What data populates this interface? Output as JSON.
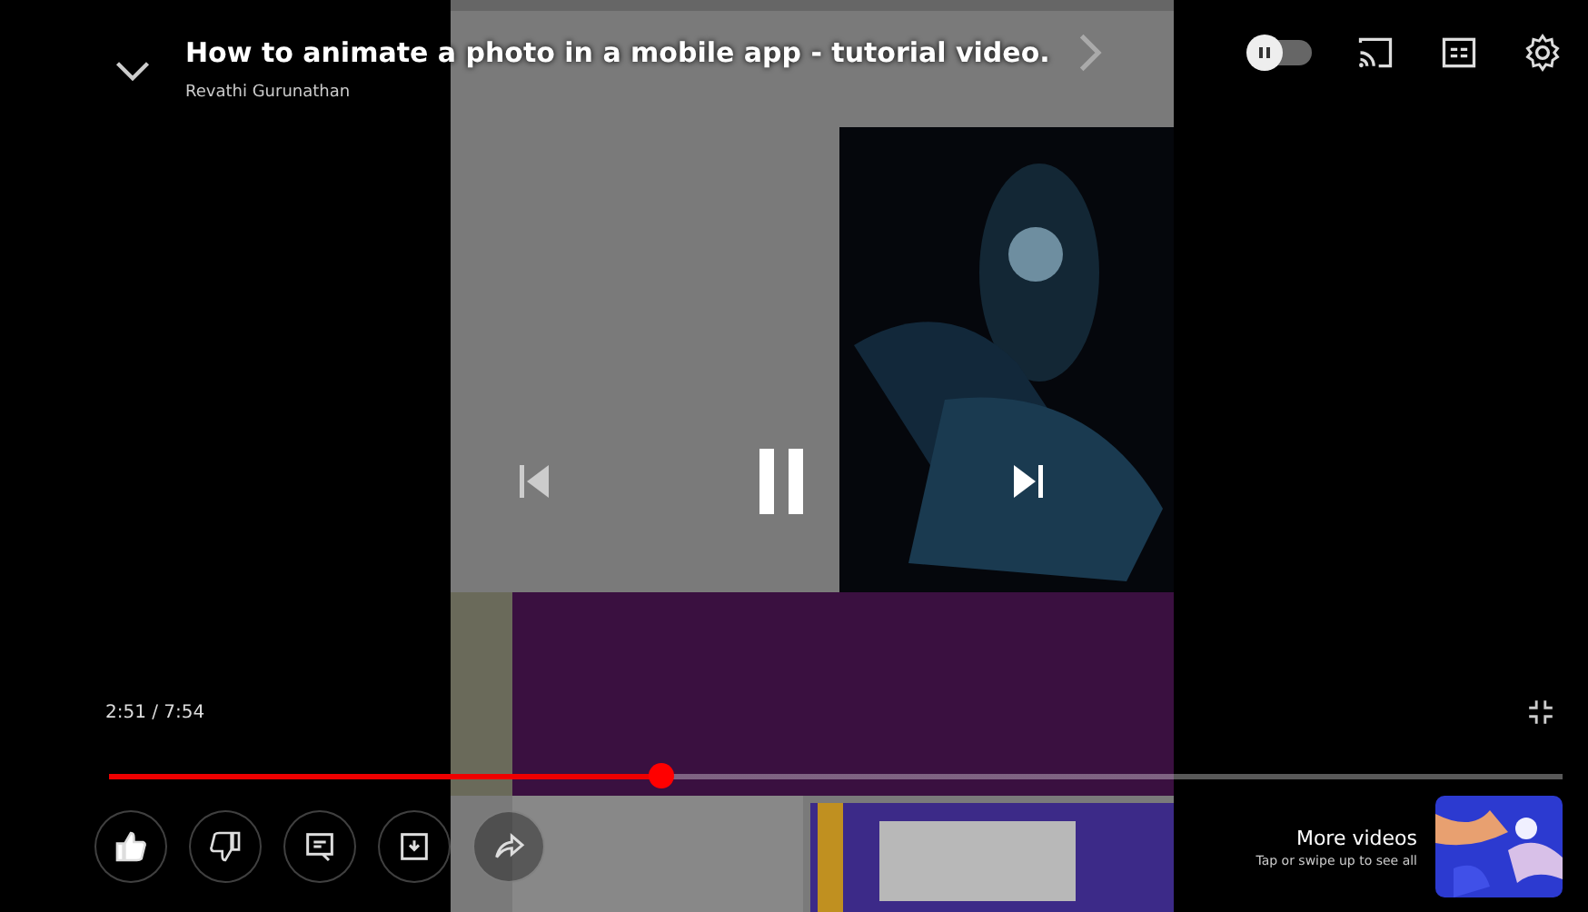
{
  "header": {
    "title": "How to animate a photo in a mobile app - tutorial video.",
    "channel": "Revathi Gurunathan",
    "autoplay": {
      "on": false
    }
  },
  "playback": {
    "playing": true
  },
  "progress": {
    "current_time": "2:51",
    "separator": " / ",
    "duration": "7:54",
    "level": 0.38
  },
  "actions": [
    {
      "kind": "like",
      "selected": true
    },
    {
      "kind": "dislike",
      "selected": false
    },
    {
      "kind": "comments",
      "selected": false
    },
    {
      "kind": "save",
      "selected": false
    },
    {
      "kind": "share",
      "selected": false
    }
  ],
  "more_videos": {
    "title": "More videos",
    "hint": "Tap or swipe up to see all"
  }
}
